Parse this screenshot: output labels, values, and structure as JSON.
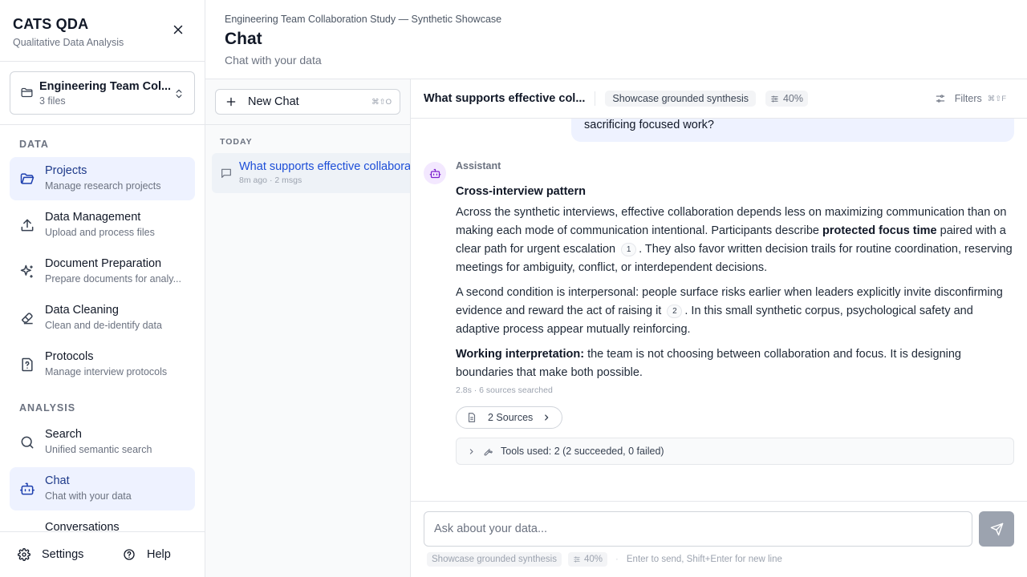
{
  "app": {
    "title": "CATS QDA",
    "subtitle": "Qualitative Data Analysis"
  },
  "project": {
    "name": "Engineering Team Col...",
    "files": "3 files"
  },
  "sections": {
    "data": "DATA",
    "analysis": "ANALYSIS"
  },
  "nav": {
    "projects": {
      "title": "Projects",
      "desc": "Manage research projects"
    },
    "data_management": {
      "title": "Data Management",
      "desc": "Upload and process files"
    },
    "document_preparation": {
      "title": "Document Preparation",
      "desc": "Prepare documents for analy..."
    },
    "data_cleaning": {
      "title": "Data Cleaning",
      "desc": "Clean and de-identify data"
    },
    "protocols": {
      "title": "Protocols",
      "desc": "Manage interview protocols"
    },
    "search": {
      "title": "Search",
      "desc": "Unified semantic search"
    },
    "chat": {
      "title": "Chat",
      "desc": "Chat with your data"
    },
    "conversations": {
      "title": "Conversations"
    }
  },
  "footer": {
    "settings": "Settings",
    "help": "Help"
  },
  "header": {
    "breadcrumb": "Engineering Team Collaboration Study — Synthetic Showcase",
    "title": "Chat",
    "subtitle": "Chat with your data"
  },
  "conversations": {
    "new_chat": "New Chat",
    "new_chat_shortcut": "⌘⇧O",
    "group_label": "TODAY",
    "items": [
      {
        "title": "What supports effective collaboration",
        "meta": "8m ago · 2 msgs"
      }
    ]
  },
  "chat": {
    "title": "What supports effective col...",
    "mode_chip": "Showcase grounded synthesis",
    "percent_chip": "40%",
    "filters_label": "Filters",
    "filters_shortcut": "⌘⇧F",
    "user_message_tail": "sacrificing focused work?",
    "assistant_label": "Assistant",
    "answer": {
      "heading": "Cross-interview pattern",
      "p1_a": "Across the synthetic interviews, effective collaboration depends less on maximizing communication than on making each mode of communication intentional. Participants describe ",
      "p1_bold": "protected focus time",
      "p1_b": " paired with a clear path for urgent escalation",
      "p1_cite": "1",
      "p1_c": ". They also favor written decision trails for routine coordination, reserving meetings for ambiguity, conflict, or interdependent decisions.",
      "p2_a": "A second condition is interpersonal: people surface risks earlier when leaders explicitly invite disconfirming evidence and reward the act of raising it",
      "p2_cite": "2",
      "p2_b": ". In this small synthetic corpus, psychological safety and adaptive process appear mutually reinforcing.",
      "p3_bold": "Working interpretation:",
      "p3_a": " the team is not choosing between collaboration and focus. It is designing boundaries that make both possible."
    },
    "meta": "2.8s · 6 sources searched",
    "sources_label": "2 Sources",
    "tools_label": "Tools used: 2 (2 succeeded, 0 failed)"
  },
  "composer": {
    "placeholder": "Ask about your data...",
    "mode_chip": "Showcase grounded synthesis",
    "percent_chip": "40%",
    "separator": "·",
    "hint": "Enter to send, Shift+Enter for new line"
  },
  "colors": {
    "accent": "#1d4ed8",
    "active_bg": "#eef2ff",
    "avatar_bg": "#f3e8ff"
  }
}
